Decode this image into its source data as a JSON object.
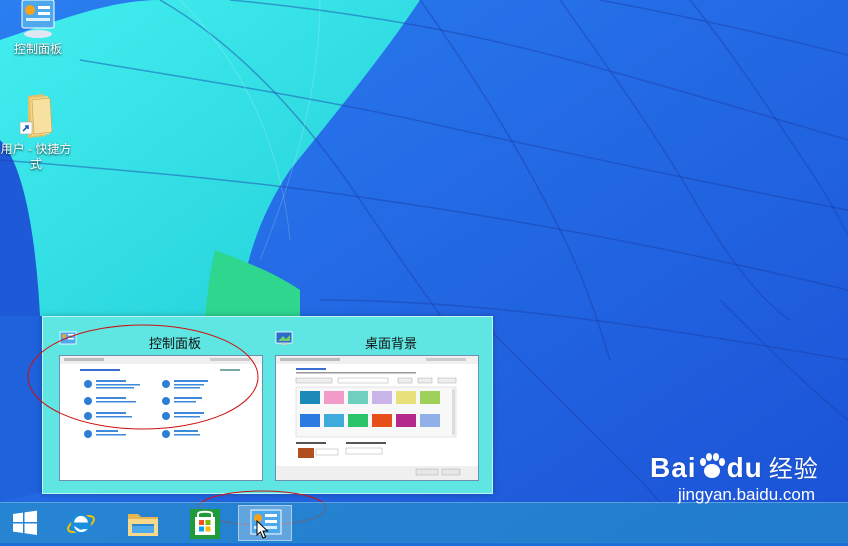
{
  "desktop": {
    "icons": [
      {
        "label": "控制面板",
        "icon": "control-panel-icon"
      },
      {
        "label": "用户 - 快捷方式",
        "icon": "folder-shortcut-icon"
      }
    ]
  },
  "thumbnails": [
    {
      "title": "控制面板",
      "icon": "control-panel-icon"
    },
    {
      "title": "桌面背景",
      "icon": "desktop-background-icon"
    }
  ],
  "taskbar": {
    "buttons": [
      {
        "name": "start",
        "icon": "windows-logo-icon"
      },
      {
        "name": "internet-explorer",
        "icon": "internet-explorer-icon"
      },
      {
        "name": "file-explorer",
        "icon": "file-explorer-icon"
      },
      {
        "name": "store",
        "icon": "store-icon"
      },
      {
        "name": "control-panel",
        "icon": "control-panel-icon",
        "active": true
      }
    ]
  },
  "watermark": {
    "brand": "Bai",
    "brand2": "du",
    "brand_sub": "经验",
    "url": "jingyan.baidu.com"
  },
  "colors": {
    "wallpaper_blue": "#2064e8",
    "wallpaper_cyan": "#35e6e6",
    "wallpaper_green": "#2fd68e",
    "panel_bg": "#5fe6e2",
    "annotation_red": "#cc1111"
  }
}
